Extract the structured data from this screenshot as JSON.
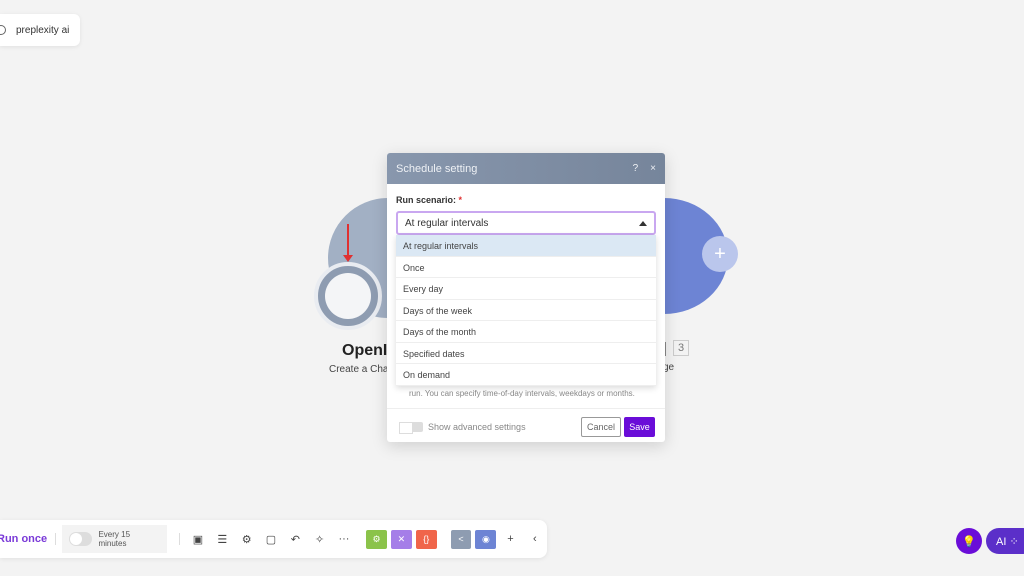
{
  "top_tag": {
    "label": "preplexity ai"
  },
  "canvas": {
    "node1_title": "OpenI",
    "node1_sub": "Create a Cha",
    "node3_sub": "ge",
    "node3_badge": "3",
    "add_icon": "+"
  },
  "dialog": {
    "title": "Schedule setting",
    "help": "?",
    "close": "×",
    "run_label": "Run scenario:",
    "required": "*",
    "selected": "At regular intervals",
    "options": [
      "At regular intervals",
      "Once",
      "Every day",
      "Days of the week",
      "Days of the month",
      "Specified dates",
      "On demand"
    ],
    "help_text": "run. You can specify time-of-day intervals, weekdays or months.",
    "advanced": "Show advanced settings",
    "cancel": "Cancel",
    "save": "Save"
  },
  "toolbar": {
    "run_once": "Run once",
    "schedule": "Every 15 minutes",
    "more": "···",
    "plus": "+",
    "collapse": "‹",
    "colors": {
      "green": "#8bc34a",
      "purple": "#a57ee8",
      "red": "#f0654a",
      "gray": "#8e9cb1",
      "blue": "#6d84d4"
    }
  },
  "ai_button": {
    "label": "AI ⁘"
  },
  "accent": "#6a0dd8"
}
